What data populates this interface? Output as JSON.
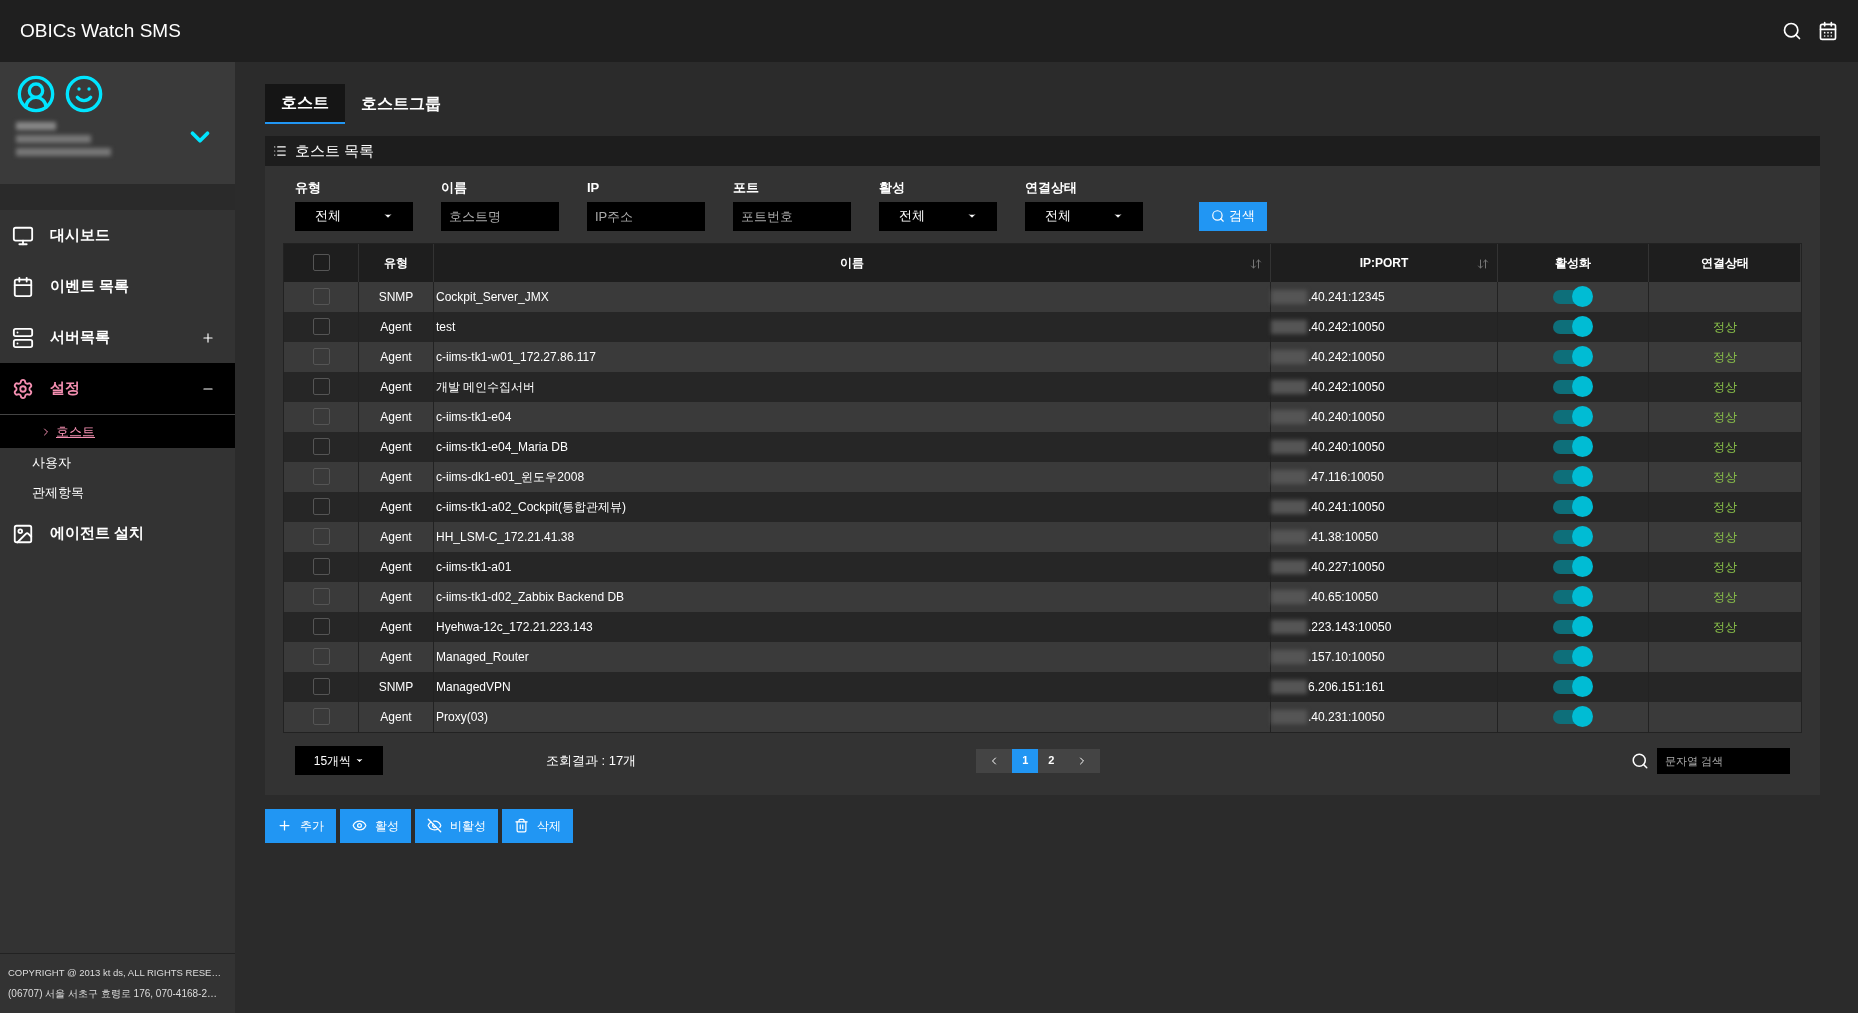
{
  "app": {
    "title": "OBICs Watch SMS"
  },
  "sidebar": {
    "menu": [
      {
        "label": "대시보드",
        "selected": false
      },
      {
        "label": "이벤트 목록",
        "selected": false
      },
      {
        "label": "서버목록",
        "selected": false,
        "expanded": false
      },
      {
        "label": "설정",
        "selected": true,
        "expanded": true,
        "children": [
          {
            "label": "호스트",
            "selected": true
          },
          {
            "label": "사용자",
            "selected": false
          },
          {
            "label": "관제항목",
            "selected": false
          }
        ]
      },
      {
        "label": "에이전트 설치",
        "selected": false
      }
    ],
    "footer": [
      "COPYRIGHT @ 2013 kt ds, ALL RIGHTS RESE…",
      "(06707) 서울 서초구 효령로 176, 070-4168-2…"
    ]
  },
  "tabs": [
    {
      "label": "호스트",
      "selected": true
    },
    {
      "label": "호스트그룹",
      "selected": false
    }
  ],
  "panel": {
    "title": "호스트 목록",
    "filters": [
      {
        "label": "유형",
        "kind": "select",
        "value": "전체"
      },
      {
        "label": "이름",
        "kind": "input",
        "placeholder": "호스트명"
      },
      {
        "label": "IP",
        "kind": "input",
        "placeholder": "IP주소"
      },
      {
        "label": "포트",
        "kind": "input",
        "placeholder": "포트번호"
      },
      {
        "label": "활성",
        "kind": "select",
        "value": "전체"
      },
      {
        "label": "연결상태",
        "kind": "select",
        "value": "전체"
      }
    ],
    "search_button": "검색",
    "table": {
      "select_all": false,
      "columns": [
        {
          "label": "유형",
          "sortable": false
        },
        {
          "label": "이름",
          "sortable": true
        },
        {
          "label": "IP:PORT",
          "sortable": true
        },
        {
          "label": "활성화",
          "sortable": false
        },
        {
          "label": "연결상태",
          "sortable": false
        }
      ],
      "rows": [
        {
          "checked": false,
          "type": "SNMP",
          "name": "Cockpit_Server_JMX",
          "ip_port": ".40.241:12345",
          "active": true
        },
        {
          "checked": false,
          "type": "Agent",
          "name": "test",
          "ip_port": ".40.242:10050",
          "active": true,
          "status": "정상"
        },
        {
          "checked": false,
          "type": "Agent",
          "name": "c-iims-tk1-w01_172.27.86.117",
          "ip_port": ".40.242:10050",
          "active": true,
          "status": "정상"
        },
        {
          "checked": false,
          "type": "Agent",
          "name": "개발 메인수집서버",
          "ip_port": ".40.242:10050",
          "active": true,
          "status": "정상"
        },
        {
          "checked": false,
          "type": "Agent",
          "name": "c-iims-tk1-e04",
          "ip_port": ".40.240:10050",
          "active": true,
          "status": "정상"
        },
        {
          "checked": false,
          "type": "Agent",
          "name": "c-iims-tk1-e04_Maria DB",
          "ip_port": ".40.240:10050",
          "active": true,
          "status": "정상"
        },
        {
          "checked": false,
          "type": "Agent",
          "name": "c-iims-dk1-e01_윈도우2008",
          "ip_port": ".47.116:10050",
          "active": true,
          "status": "정상"
        },
        {
          "checked": false,
          "type": "Agent",
          "name": "c-iims-tk1-a02_Cockpit(통합관제뷰)",
          "ip_port": ".40.241:10050",
          "active": true,
          "status": "정상"
        },
        {
          "checked": false,
          "type": "Agent",
          "name": "HH_LSM-C_172.21.41.38",
          "ip_port": ".41.38:10050",
          "active": true,
          "status": "정상"
        },
        {
          "checked": false,
          "type": "Agent",
          "name": "c-iims-tk1-a01",
          "ip_port": ".40.227:10050",
          "active": true,
          "status": "정상"
        },
        {
          "checked": false,
          "type": "Agent",
          "name": "c-iims-tk1-d02_Zabbix Backend DB",
          "ip_port": ".40.65:10050",
          "active": true,
          "status": "정상"
        },
        {
          "checked": false,
          "type": "Agent",
          "name": "Hyehwa-12c_172.21.223.143",
          "ip_port": ".223.143:10050",
          "active": true,
          "status": "정상"
        },
        {
          "checked": false,
          "type": "Agent",
          "name": "Managed_Router",
          "ip_port": ".157.10:10050",
          "active": true
        },
        {
          "checked": false,
          "type": "SNMP",
          "name": "ManagedVPN",
          "ip_port": "6.206.151:161",
          "active": true
        },
        {
          "checked": false,
          "type": "Agent",
          "name": "Proxy(03)",
          "ip_port": ".40.231:10050",
          "active": true
        }
      ]
    },
    "page_size": "15개씩",
    "result_count": "조회결과 : 17개",
    "pages": [
      {
        "label": "1",
        "selected": true
      },
      {
        "label": "2",
        "selected": false
      }
    ],
    "text_search": {
      "placeholder": "문자열 검색"
    }
  },
  "actions": [
    "추가",
    "활성",
    "비활성",
    "삭제"
  ]
}
